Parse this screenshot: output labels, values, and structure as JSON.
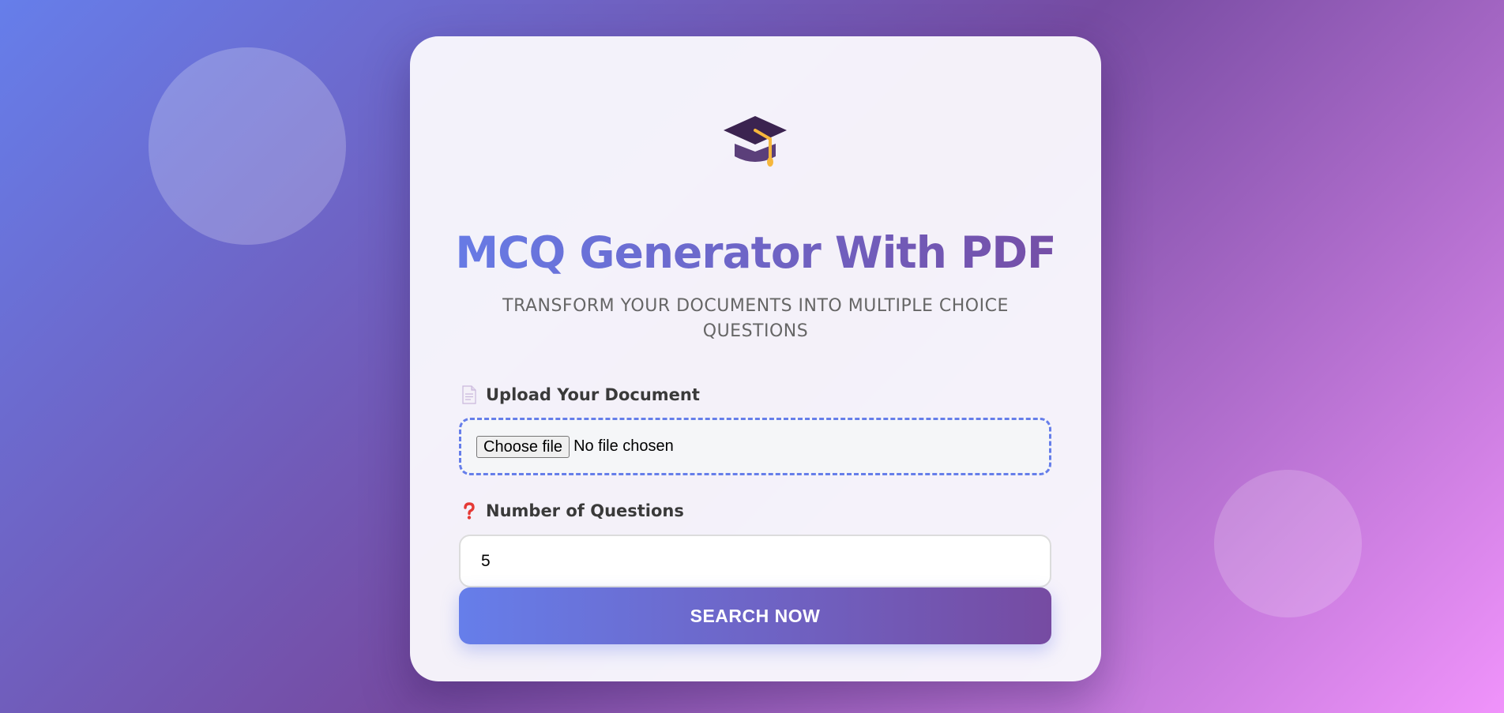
{
  "page": {
    "icon": "graduation-cap-icon",
    "title": "MCQ Generator With PDF",
    "subtitle": "TRANSFORM YOUR DOCUMENTS INTO MULTIPLE CHOICE QUESTIONS"
  },
  "upload": {
    "icon": "document-icon",
    "label": "Upload Your Document",
    "button_label": "Choose file",
    "status": "No file chosen"
  },
  "questions": {
    "icon": "question-mark-icon",
    "label": "Number of Questions",
    "value": "5"
  },
  "submit": {
    "label": "SEARCH NOW"
  },
  "colors": {
    "accent_start": "#667eea",
    "accent_end": "#764ba2",
    "background_end": "#f093fb",
    "question_icon": "#e53935"
  }
}
